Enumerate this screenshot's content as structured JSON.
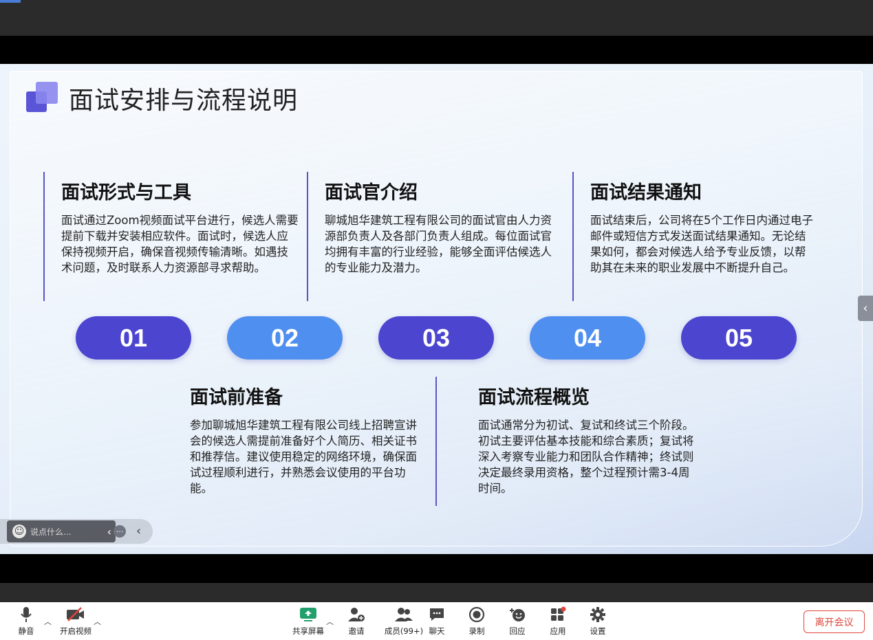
{
  "slide": {
    "title": "面试安排与流程说明",
    "sections": [
      {
        "heading": "面试形式与工具",
        "body": "面试通过Zoom视频面试平台进行，候选人需要提前下载并安装相应软件。面试时，候选人应保持视频开启，确保音视频传输清晰。如遇技术问题，及时联系人力资源部寻求帮助。"
      },
      {
        "heading": "面试官介绍",
        "body": "聊城旭华建筑工程有限公司的面试官由人力资源部负责人及各部门负责人组成。每位面试官均拥有丰富的行业经验，能够全面评估候选人的专业能力及潜力。"
      },
      {
        "heading": "面试结果通知",
        "body": "面试结束后，公司将在5个工作日内通过电子邮件或短信方式发送面试结果通知。无论结果如何，都会对候选人给予专业反馈，以帮助其在未来的职业发展中不断提升自己。"
      },
      {
        "heading": "面试前准备",
        "body": "参加聊城旭华建筑工程有限公司线上招聘宣讲会的候选人需提前准备好个人简历、相关证书和推荐信。建议使用稳定的网络环境，确保面试过程顺利进行，并熟悉会议使用的平台功能。"
      },
      {
        "heading": "面试流程概览",
        "body": "面试通常分为初试、复试和终试三个阶段。初试主要评估基本技能和综合素质；复试将深入考察专业能力和团队合作精神；终试则决定最终录用资格，整个过程预计需3-4周时间。"
      }
    ],
    "steps": [
      "01",
      "02",
      "03",
      "04",
      "05"
    ],
    "colors": {
      "primary": "#4b45cf",
      "secondary": "#4f8ff0"
    }
  },
  "reaction": {
    "placeholder": "说点什么..."
  },
  "toolbar": {
    "mute": "静音",
    "video": "开启视频",
    "share": "共享屏幕",
    "invite": "邀请",
    "members": "成员(99+)",
    "chat": "聊天",
    "record": "录制",
    "react": "回应",
    "apps": "应用",
    "settings": "设置",
    "leave": "离开会议"
  }
}
